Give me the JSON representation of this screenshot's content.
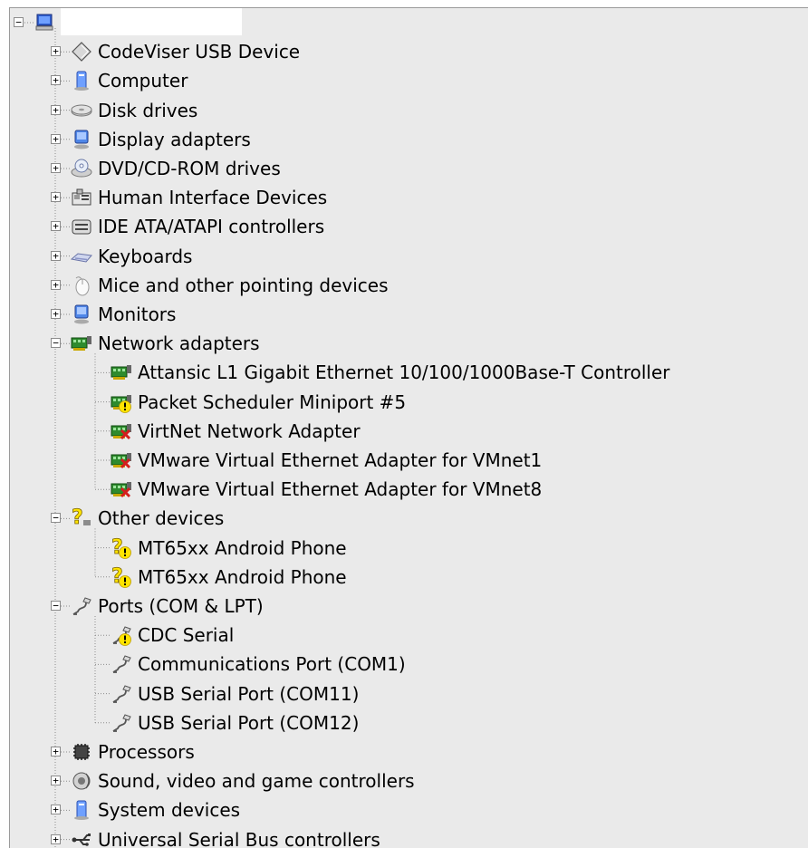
{
  "tree": {
    "root": {
      "label": "",
      "icon": "computer-monitor-icon",
      "expanded": true
    },
    "categories": [
      {
        "label": "CodeViser USB Device",
        "icon": "diamond-device-icon",
        "expanded": false,
        "children": []
      },
      {
        "label": "Computer",
        "icon": "computer-icon",
        "expanded": false,
        "children": []
      },
      {
        "label": "Disk drives",
        "icon": "disk-drive-icon",
        "expanded": false,
        "children": []
      },
      {
        "label": "Display adapters",
        "icon": "display-adapter-icon",
        "expanded": false,
        "children": []
      },
      {
        "label": "DVD/CD-ROM drives",
        "icon": "dvd-drive-icon",
        "expanded": false,
        "children": []
      },
      {
        "label": "Human Interface Devices",
        "icon": "hid-icon",
        "expanded": false,
        "children": []
      },
      {
        "label": "IDE ATA/ATAPI controllers",
        "icon": "ide-controller-icon",
        "expanded": false,
        "children": []
      },
      {
        "label": "Keyboards",
        "icon": "keyboard-icon",
        "expanded": false,
        "children": []
      },
      {
        "label": "Mice and other pointing devices",
        "icon": "mouse-icon",
        "expanded": false,
        "children": []
      },
      {
        "label": "Monitors",
        "icon": "monitor-icon",
        "expanded": false,
        "children": []
      },
      {
        "label": "Network adapters",
        "icon": "network-adapter-icon",
        "expanded": true,
        "children": [
          {
            "label": "Attansic L1 Gigabit Ethernet 10/100/1000Base-T Controller",
            "icon": "network-adapter-icon",
            "status": "ok"
          },
          {
            "label": "Packet Scheduler Miniport #5",
            "icon": "network-adapter-icon",
            "status": "warning"
          },
          {
            "label": "VirtNet Network Adapter",
            "icon": "network-adapter-icon",
            "status": "disabled"
          },
          {
            "label": "VMware Virtual Ethernet Adapter for VMnet1",
            "icon": "network-adapter-icon",
            "status": "disabled"
          },
          {
            "label": "VMware Virtual Ethernet Adapter for VMnet8",
            "icon": "network-adapter-icon",
            "status": "disabled"
          }
        ]
      },
      {
        "label": "Other devices",
        "icon": "unknown-device-icon",
        "expanded": true,
        "children": [
          {
            "label": "MT65xx Android Phone",
            "icon": "unknown-device-icon",
            "status": "warning"
          },
          {
            "label": "MT65xx Android Phone",
            "icon": "unknown-device-icon",
            "status": "warning"
          }
        ]
      },
      {
        "label": "Ports (COM & LPT)",
        "icon": "port-icon",
        "expanded": true,
        "children": [
          {
            "label": "CDC Serial",
            "icon": "port-icon",
            "status": "warning"
          },
          {
            "label": "Communications Port (COM1)",
            "icon": "port-icon",
            "status": "ok"
          },
          {
            "label": "USB Serial Port (COM11)",
            "icon": "port-icon",
            "status": "ok"
          },
          {
            "label": "USB Serial Port (COM12)",
            "icon": "port-icon",
            "status": "ok"
          }
        ]
      },
      {
        "label": "Processors",
        "icon": "processor-icon",
        "expanded": false,
        "children": []
      },
      {
        "label": "Sound, video and game controllers",
        "icon": "sound-icon",
        "expanded": false,
        "children": []
      },
      {
        "label": "System devices",
        "icon": "system-device-icon",
        "expanded": false,
        "children": []
      },
      {
        "label": "Universal Serial Bus controllers",
        "icon": "usb-icon",
        "expanded": false,
        "children": []
      }
    ]
  },
  "colors": {
    "panel_background": "#eaeaea",
    "tree_lines": "#8c8c8c",
    "warning_yellow": "#ffe400",
    "disabled_red": "#d41e1e",
    "adapter_green": "#2e8b2e"
  }
}
